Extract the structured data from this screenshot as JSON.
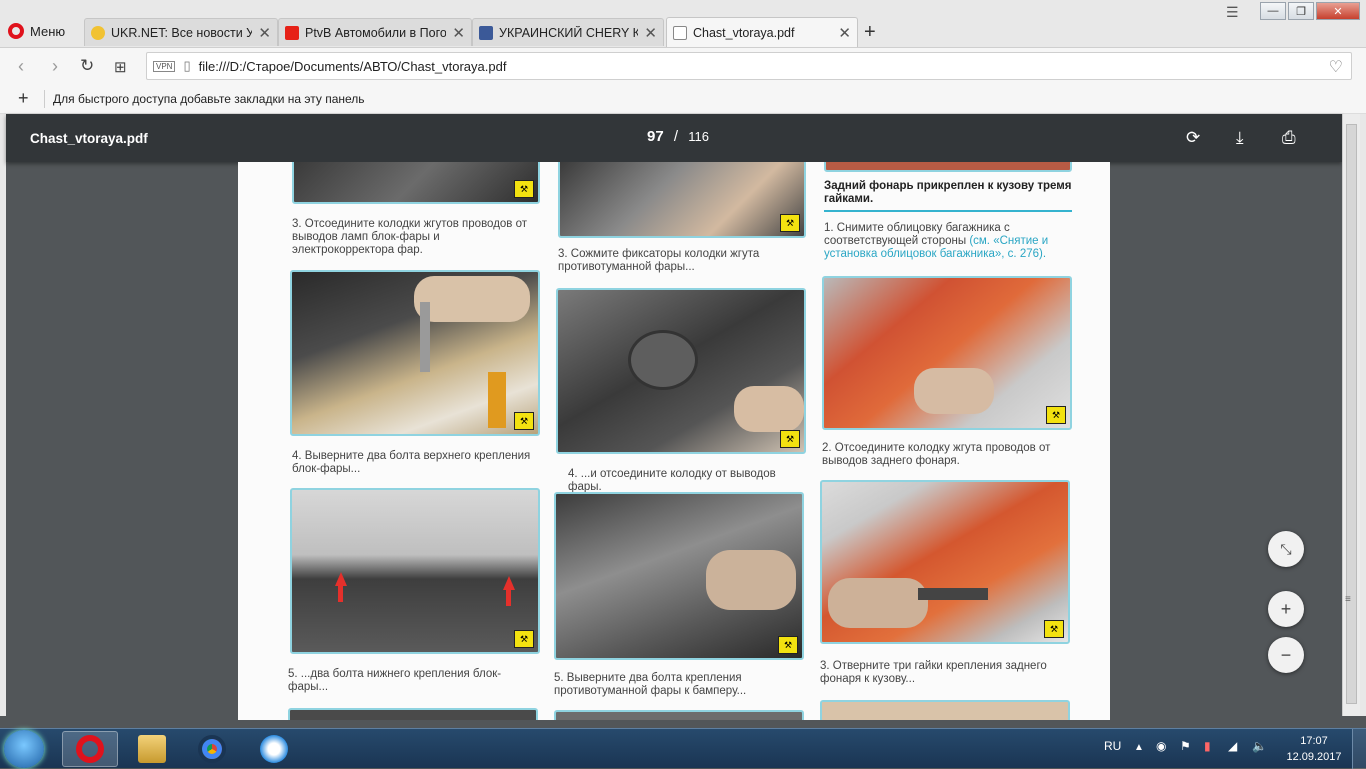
{
  "browser": {
    "menu_label": "Меню",
    "tabs": [
      {
        "title": "UKR.NET: Все новости Укр",
        "favicon_color": "#f1c232"
      },
      {
        "title": "PtvB Автомобили в Пого",
        "favicon_color": "#e62117"
      },
      {
        "title": "УКРАИНСКИЙ CHERY КЛ",
        "favicon_color": "#3b5998"
      },
      {
        "title": "Chast_vtoraya.pdf",
        "favicon_color": "#ffffff",
        "active": true
      }
    ],
    "new_tab": "+",
    "close_glyph": "✕",
    "url": "file:///D:/Старое/Documents/АВТО/Chast_vtoraya.pdf",
    "vpn_label": "VPN",
    "bookmarks_hint": "Для быстрого доступа добавьте закладки на эту панель"
  },
  "pdf": {
    "filename": "Chast_vtoraya.pdf",
    "current_page": "97",
    "separator": "/",
    "total_pages": "116"
  },
  "document": {
    "col1": {
      "caption3": "3. Отсоедините колодки жгутов проводов от выводов ламп блок-фары и электрокорректора фар.",
      "caption4": "4. Выверните два болта верхнего крепления блок-фары...",
      "caption5": "5. ...два болта нижнего крепления блок-фары..."
    },
    "col2": {
      "caption3": "3. Сожмите фиксаторы колодки жгута противотуманной фары...",
      "caption4": "4. ...и отсоедините колодку от выводов фары.",
      "caption5": "5. Выверните два болта крепления противотуманной фары к бамперу..."
    },
    "col3": {
      "heading": "Задний фонарь прикреплен к кузову тремя гайками.",
      "caption1_text": "1. Снимите облицовку багажника с соответствующей стороны",
      "caption1_link": "(см. «Снятие и установка облицовок багажника», с. 276).",
      "caption2": "2. Отсоедините колодку жгута проводов от выводов заднего фонаря.",
      "caption3": "3. Отверните три гайки крепления заднего фонаря к кузову..."
    }
  },
  "taskbar": {
    "lang": "RU",
    "time": "17:07",
    "date": "12.09.2017"
  }
}
